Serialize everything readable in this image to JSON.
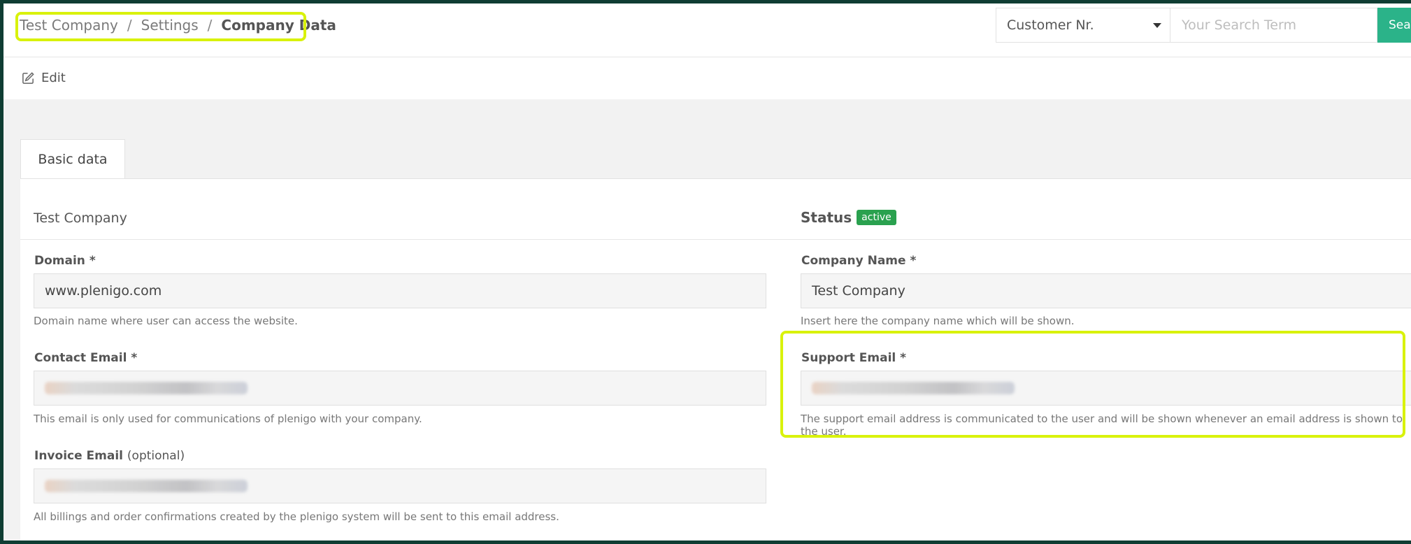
{
  "breadcrumb": {
    "items": [
      "Test Company",
      "Settings"
    ],
    "current": "Company Data",
    "separator": "/"
  },
  "search": {
    "select_value": "Customer Nr.",
    "placeholder": "Your Search Term",
    "button_label": "Sea"
  },
  "toolbar": {
    "edit_label": "Edit"
  },
  "tabs": {
    "active": "Basic data"
  },
  "company": {
    "title": "Test Company"
  },
  "status": {
    "label": "Status",
    "badge": "active",
    "badge_color": "#2aa14f"
  },
  "fields": {
    "domain": {
      "label": "Domain",
      "required": "*",
      "value": "www.plenigo.com",
      "help": "Domain name where user can access the website."
    },
    "company_name": {
      "label": "Company Name",
      "required": "*",
      "value": "Test Company",
      "help": "Insert here the company name which will be shown."
    },
    "contact_email": {
      "label": "Contact Email",
      "required": "*",
      "help": "This email is only used for communications of plenigo with your company."
    },
    "support_email": {
      "label": "Support Email",
      "required": "*",
      "help": "The support email address is communicated to the user and will be shown whenever an email address is shown to the user."
    },
    "invoice_email": {
      "label": "Invoice Email",
      "optional": "(optional)",
      "help": "All billings and order confirmations created by the plenigo system will be sent to this email address."
    }
  },
  "colors": {
    "accent": "#2bb389",
    "highlight": "#d9f20c",
    "frame": "#0f3d33"
  }
}
